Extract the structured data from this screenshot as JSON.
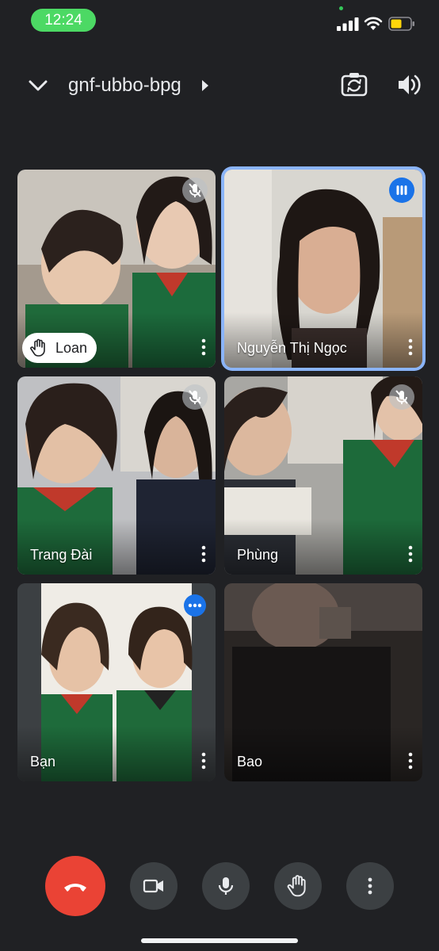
{
  "status_bar": {
    "time": "12:24"
  },
  "header": {
    "meeting_code": "gnf-ubbo-bpg"
  },
  "tiles": [
    {
      "name": "Loan",
      "muted": true,
      "hand_raised": true
    },
    {
      "name": "Nguyễn Thị Ngọc",
      "muted": false,
      "speaking": true
    },
    {
      "name": "Trang Đài",
      "muted": true
    },
    {
      "name": "Phùng",
      "muted": true
    },
    {
      "name": "Bạn",
      "muted": false
    },
    {
      "name": "Bao",
      "muted": false
    }
  ],
  "colors": {
    "end_call": "#ea4335",
    "accent": "#1a73e8",
    "active_border": "#8ab4f8",
    "background": "#202124"
  }
}
